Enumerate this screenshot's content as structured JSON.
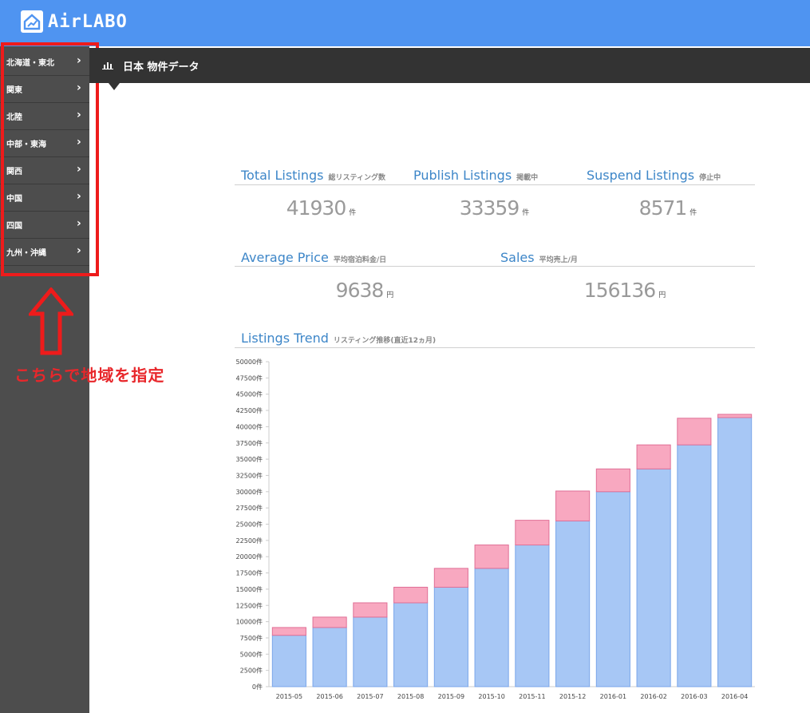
{
  "app": {
    "logo_text": "AirLABO",
    "page_title": "日本 物件データ"
  },
  "sidebar": {
    "items": [
      {
        "label": "北海道・東北"
      },
      {
        "label": "関東"
      },
      {
        "label": "北陸"
      },
      {
        "label": "中部・東海"
      },
      {
        "label": "関西"
      },
      {
        "label": "中国"
      },
      {
        "label": "四国"
      },
      {
        "label": "九州・沖縄"
      }
    ],
    "chevron": "›"
  },
  "annotation": {
    "text": "こちらで地域を指定"
  },
  "stats": {
    "total": {
      "title": "Total Listings",
      "sub": "総リスティング数",
      "value": "41930",
      "unit": "件"
    },
    "publish": {
      "title": "Publish Listings",
      "sub": "掲載中",
      "value": "33359",
      "unit": "件"
    },
    "suspend": {
      "title": "Suspend Listings",
      "sub": "停止中",
      "value": "8571",
      "unit": "件"
    },
    "price": {
      "title": "Average Price",
      "sub": "平均宿泊料金/日",
      "value": "9638",
      "unit": "円"
    },
    "sales": {
      "title": "Sales",
      "sub": "平均売上/月",
      "value": "156136",
      "unit": "円"
    }
  },
  "trend": {
    "title": "Listings Trend",
    "sub": "リスティング推移(直近12ヵ月)"
  },
  "colors": {
    "accent": "#4f94f1",
    "publish_bar": "#a7c7f5",
    "suspend_bar": "#f8a8c0",
    "annotation_red": "#ee1b1b"
  },
  "chart_data": {
    "type": "bar",
    "stacked": true,
    "categories": [
      "2015-05",
      "2015-06",
      "2015-07",
      "2015-08",
      "2015-09",
      "2015-10",
      "2015-11",
      "2015-12",
      "2016-01",
      "2016-02",
      "2016-03",
      "2016-04"
    ],
    "series": [
      {
        "values": [
          7900,
          9100,
          10700,
          12900,
          15300,
          18200,
          21800,
          25500,
          30000,
          33500,
          37200,
          41400
        ]
      },
      {
        "values": [
          1200,
          1600,
          2200,
          2400,
          2900,
          3600,
          3800,
          4600,
          3500,
          3700,
          4100,
          500
        ]
      }
    ],
    "ylim": [
      0,
      50000
    ],
    "ystep": 2500,
    "tick_suffix": "件",
    "grid": false
  }
}
